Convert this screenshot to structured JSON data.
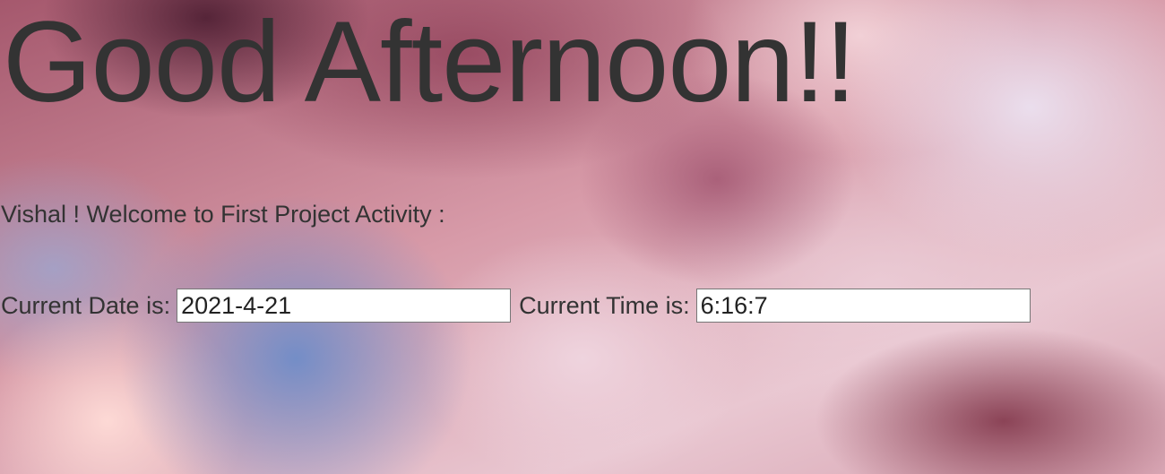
{
  "greeting": "Good Afternoon!!",
  "welcome": "Vishal ! Welcome to First Project Activity :",
  "date_field": {
    "label": "Current Date is:",
    "value": "2021-4-21"
  },
  "time_field": {
    "label": "Current Time is:",
    "value": "6:16:7"
  },
  "colors": {
    "text": "#333333",
    "input_background": "#ffffff",
    "input_border": "#767676"
  },
  "background": "cloudy-sky-image"
}
